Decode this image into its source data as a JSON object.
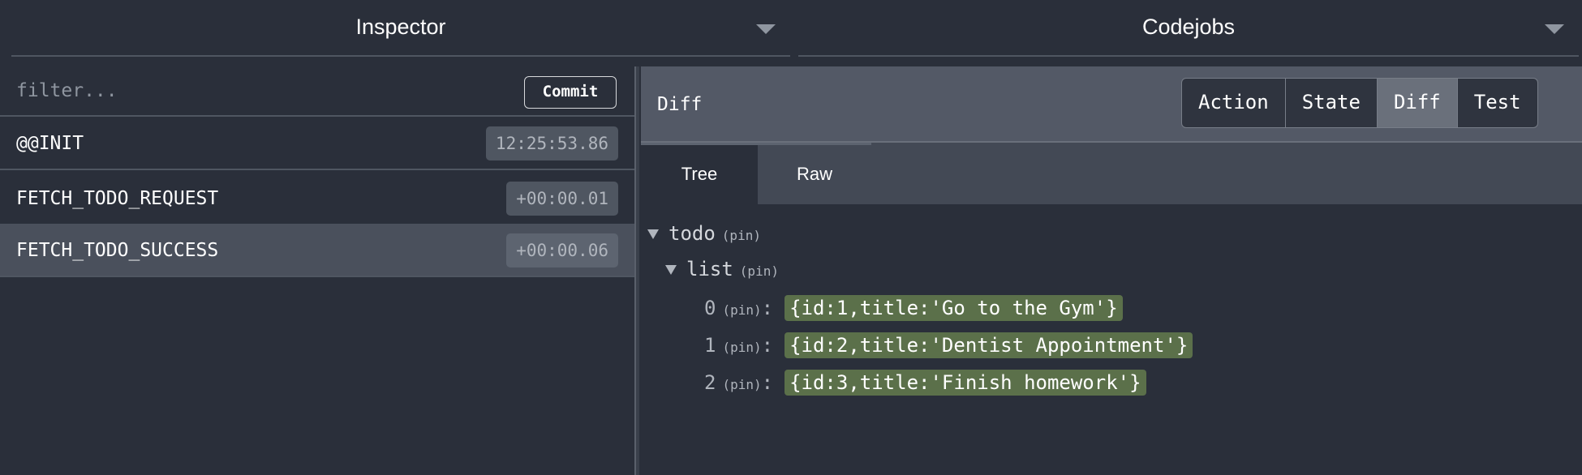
{
  "header": {
    "left_selector": "Inspector",
    "right_selector": "Codejobs"
  },
  "actions": {
    "filter_placeholder": "filter...",
    "commit_label": "Commit",
    "items": [
      {
        "name": "@@INIT",
        "time": "12:25:53.86"
      },
      {
        "name": "FETCH_TODO_REQUEST",
        "time": "+00:00.01"
      },
      {
        "name": "FETCH_TODO_SUCCESS",
        "time": "+00:00.06"
      }
    ]
  },
  "monitor": {
    "title": "Diff",
    "tabs": [
      "Action",
      "State",
      "Diff",
      "Test"
    ],
    "active_tab": "Diff",
    "subtabs": [
      "Tree",
      "Raw"
    ],
    "active_subtab": "Tree"
  },
  "tree": {
    "root_key": "todo",
    "child_key": "list",
    "pin_label": "(pin)",
    "colon": ":",
    "entries": [
      {
        "index": "0",
        "value": "{id:1,title:'Go to the Gym'}"
      },
      {
        "index": "1",
        "value": "{id:2,title:'Dentist Appointment'}"
      },
      {
        "index": "2",
        "value": "{id:3,title:'Finish homework'}"
      }
    ]
  },
  "colors": {
    "background": "#2a2f3a",
    "header_bar": "#535966",
    "added_value": "#5b704a",
    "selected_row": "#4a505c"
  }
}
